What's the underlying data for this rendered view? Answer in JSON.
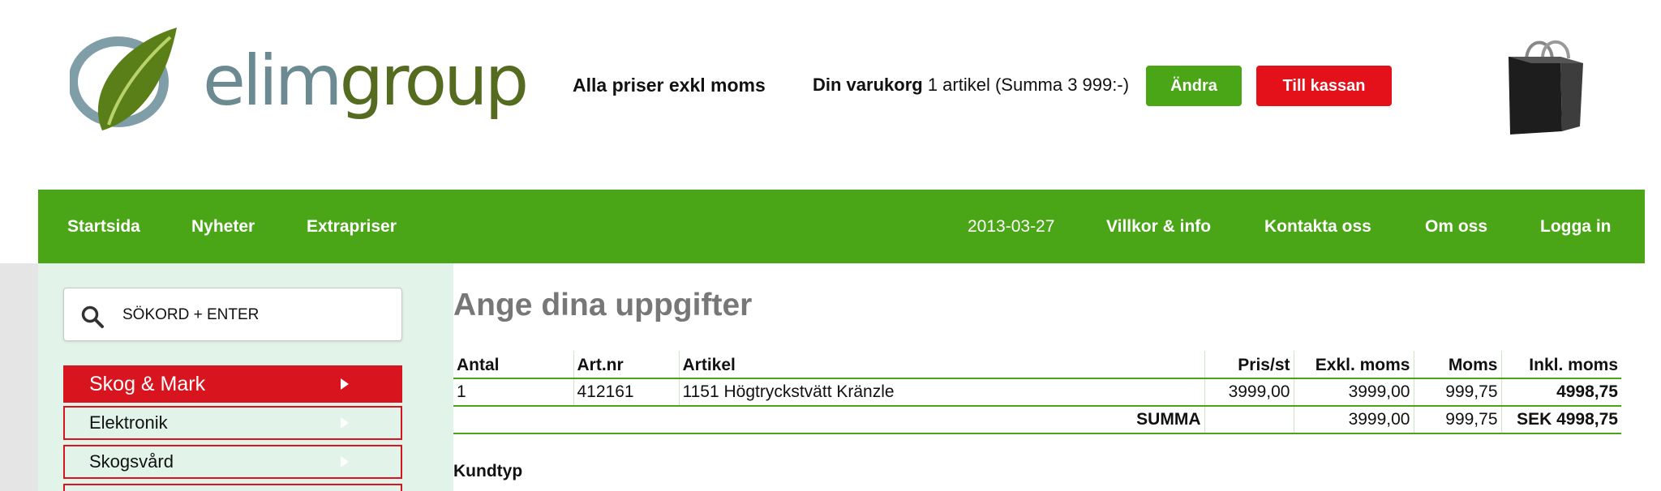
{
  "header": {
    "logo_text_1": "elim",
    "logo_text_2": "group",
    "price_note": "Alla priser exkl moms",
    "cart_label": "Din varukorg",
    "cart_summary": "1 artikel (Summa 3 999:-)",
    "change_button": "Ändra",
    "checkout_button": "Till kassan"
  },
  "nav": {
    "left": [
      "Startsida",
      "Nyheter",
      "Extrapriser"
    ],
    "date": "2013-03-27",
    "right": [
      "Villkor & info",
      "Kontakta oss",
      "Om oss",
      "Logga in"
    ]
  },
  "sidebar": {
    "search_text": "SÖKORD + ENTER",
    "categories": [
      "Skog & Mark",
      "Elektronik",
      "Skogsvård"
    ]
  },
  "main": {
    "title": "Ange dina uppgifter",
    "table": {
      "headers": [
        "Antal",
        "Art.nr",
        "Artikel",
        "Pris/st",
        "Exkl. moms",
        "Moms",
        "Inkl. moms"
      ],
      "rows": [
        [
          "1",
          "412161",
          "1151 Högtryckstvätt Kränzle",
          "3999,00",
          "3999,00",
          "999,75",
          "4998,75"
        ]
      ],
      "summary": {
        "label": "SUMMA",
        "exkl": "3999,00",
        "moms": "999,75",
        "inkl": "SEK 4998,75"
      }
    },
    "customer_type_label": "Kundtyp"
  },
  "colors": {
    "brand_green": "#4aa617",
    "brand_red": "#d8151f",
    "sidebar_bg": "#e2f3ea",
    "title_gray": "#777777"
  },
  "icons": {
    "search": "search-icon",
    "bag": "shopping-bag-icon",
    "logo": "leaf-logo-icon",
    "arrow": "chevron-right-icon"
  }
}
